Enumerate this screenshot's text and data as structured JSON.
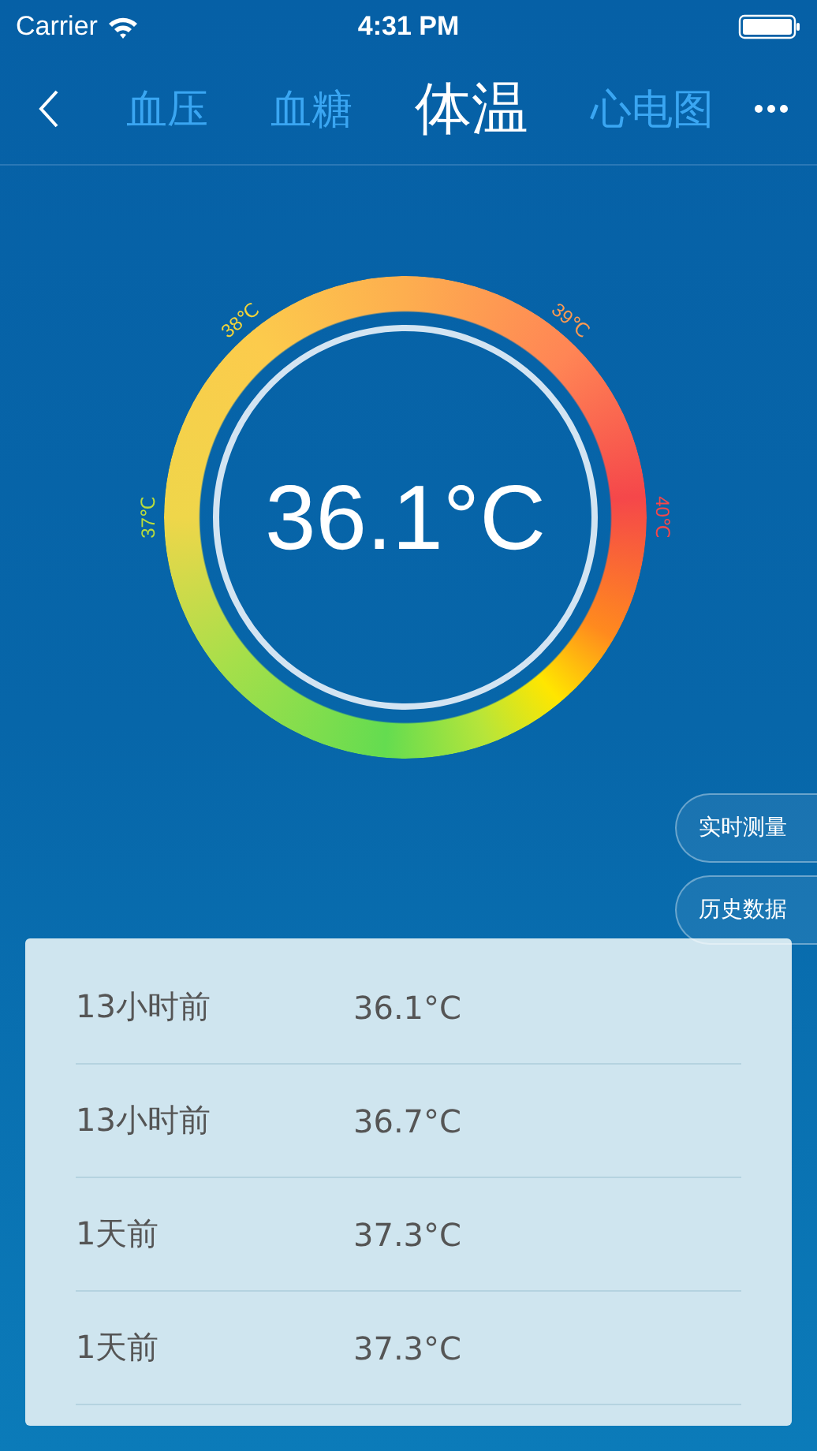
{
  "status_bar": {
    "carrier": "Carrier",
    "time": "4:31 PM"
  },
  "tabs": [
    {
      "label": "血压",
      "selected": false
    },
    {
      "label": "血糖",
      "selected": false
    },
    {
      "label": "体温",
      "selected": true
    },
    {
      "label": "心电图",
      "selected": false
    }
  ],
  "gauge": {
    "reading": "36.1°C",
    "ticks": [
      {
        "label": "37℃",
        "color": "#b9dc3c"
      },
      {
        "label": "38℃",
        "color": "#f2d43a"
      },
      {
        "label": "39℃",
        "color": "#ff9a50"
      },
      {
        "label": "40℃",
        "color": "#f5474a"
      }
    ]
  },
  "side_buttons": [
    "实时测量",
    "历史数据"
  ],
  "history": [
    {
      "time": "13小时前",
      "value": "36.1°C"
    },
    {
      "time": "13小时前",
      "value": "36.7°C"
    },
    {
      "time": "1天前",
      "value": "37.3°C"
    },
    {
      "time": "1天前",
      "value": "37.3°C"
    }
  ]
}
